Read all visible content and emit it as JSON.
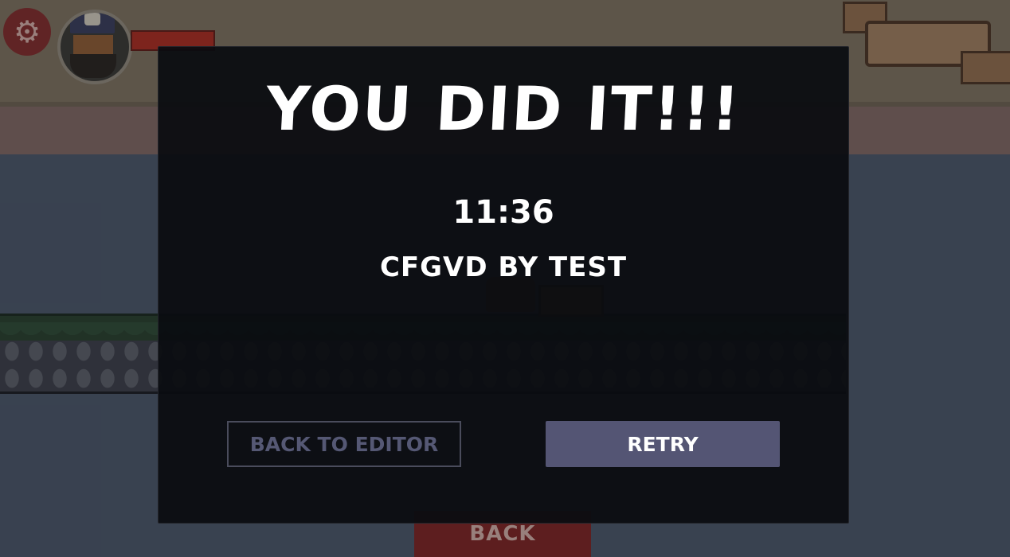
{
  "hud": {
    "settings_icon": "gear-icon",
    "settings_glyph": "⚙",
    "avatar": "pirate-portrait",
    "health_color": "#a52c22"
  },
  "modal": {
    "title": "YOU DID IT!!!",
    "time": "11:36",
    "level_credit": "CFGVD BY TEST",
    "back_to_editor_label": "BACK TO EDITOR",
    "retry_label": "RETRY"
  },
  "footer": {
    "back_label": "BACK"
  },
  "colors": {
    "modal_bg": "#0a0c10",
    "retry_bg": "#545574",
    "back_bg": "#7a2424",
    "settings_bg": "#7e2d2d"
  }
}
